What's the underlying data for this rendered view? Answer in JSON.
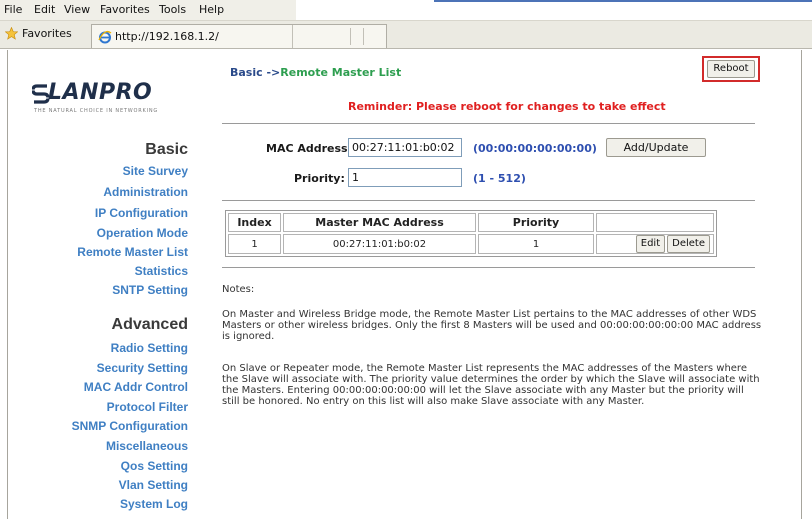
{
  "menu": {
    "items": [
      "File",
      "Edit",
      "View",
      "Favorites",
      "Tools",
      "Help"
    ]
  },
  "favorites_bar": {
    "label": "Favorites",
    "tab_url": "http://192.168.1.2/"
  },
  "logo": {
    "brand": "LANPRO",
    "tagline": "THE NATURAL CHOICE IN NETWORKING"
  },
  "sidebar": {
    "basic_heading": "Basic",
    "basic_items": [
      "Site Survey",
      "Administration",
      "IP Configuration",
      "Operation Mode",
      "Remote Master List",
      "Statistics",
      "SNTP Setting"
    ],
    "advanced_heading": "Advanced",
    "advanced_items": [
      "Radio Setting",
      "Security Setting",
      "MAC Addr Control",
      "Protocol Filter",
      "SNMP Configuration",
      "Miscellaneous",
      "Qos Setting",
      "Vlan Setting",
      "System Log"
    ]
  },
  "breadcrumb": {
    "section": "Basic ->",
    "page": "Remote Master List"
  },
  "reboot_label": "Reboot",
  "reminder": "Reminder: Please reboot for changes to take effect",
  "form": {
    "mac_label": "MAC Address:",
    "mac_value": "00:27:11:01:b0:02",
    "mac_hint": "(00:00:00:00:00:00)",
    "priority_label": "Priority:",
    "priority_value": "1",
    "priority_hint": "(1 - 512)",
    "add_update_label": "Add/Update"
  },
  "table": {
    "headers": [
      "Index",
      "Master MAC Address",
      "Priority",
      ""
    ],
    "rows": [
      {
        "index": "1",
        "mac": "00:27:11:01:b0:02",
        "priority": "1",
        "edit": "Edit",
        "delete": "Delete"
      }
    ]
  },
  "notes": {
    "label": "Notes:",
    "paragraph_1": "On Master and Wireless Bridge mode, the Remote Master List pertains to the MAC addresses of other WDS Masters or other wireless bridges. Only the first 8 Masters will be used and 00:00:00:00:00:00 MAC address is ignored.",
    "paragraph_2": "On Slave or Repeater mode, the Remote Master List represents the MAC addresses of the Masters where the Slave will associate with. The priority value determines the order by which the Slave will associate with the Masters. Entering 00:00:00:00:00:00 will let the Slave associate with any Master but the priority will still be honored. No entry on this list will also make Slave associate with any Master."
  },
  "colors": {
    "link": "#3f7fc3",
    "reminder": "#e02020",
    "breadcrumb_page": "#2d9e4f",
    "highlight_frame": "#d22b2b"
  }
}
